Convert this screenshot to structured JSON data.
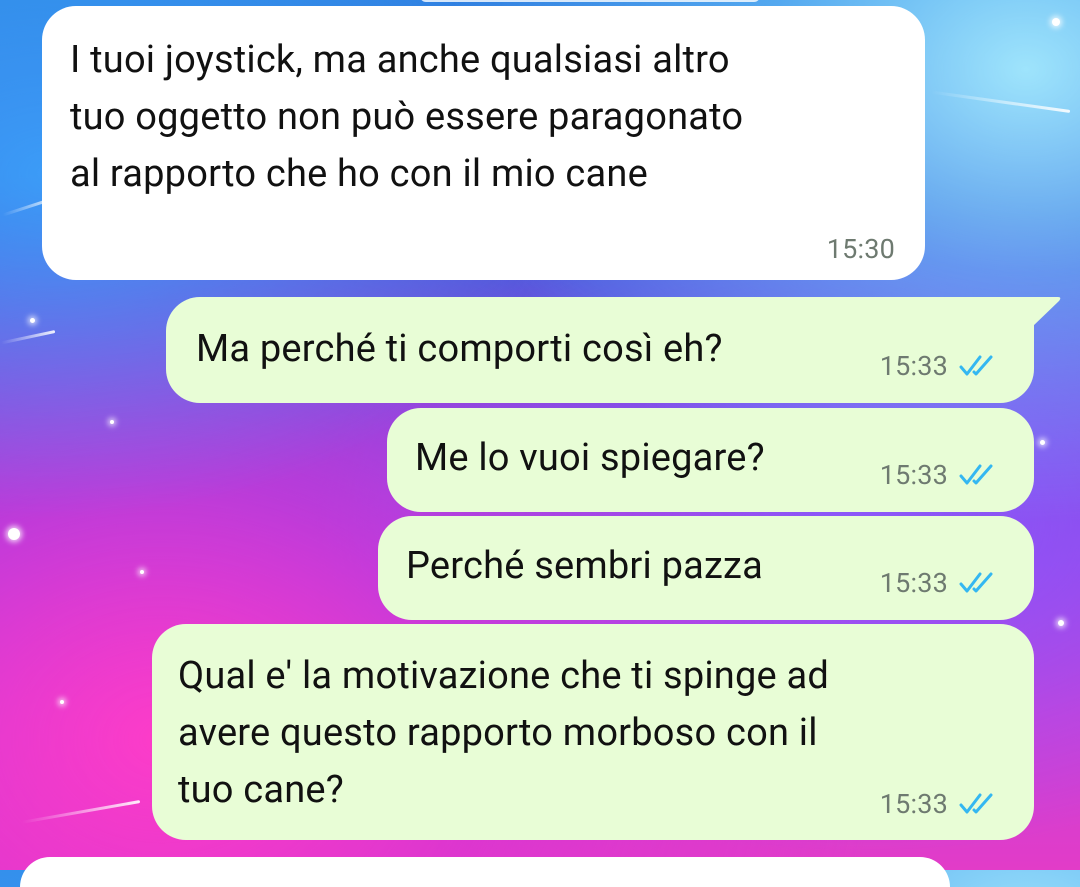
{
  "chat": {
    "messages": [
      {
        "direction": "incoming",
        "text": "I tuoi joystick, ma anche qualsiasi altro\ntuo oggetto non può essere paragonato\nal rapporto che ho con il mio cane",
        "time": "15:30"
      },
      {
        "direction": "outgoing",
        "text": "Ma perché ti comporti così eh?",
        "time": "15:33",
        "status_icon": "double-check-read-icon"
      },
      {
        "direction": "outgoing",
        "text": "Me lo vuoi spiegare?",
        "time": "15:33",
        "status_icon": "double-check-read-icon"
      },
      {
        "direction": "outgoing",
        "text": "Perché sembri pazza",
        "time": "15:33",
        "status_icon": "double-check-read-icon"
      },
      {
        "direction": "outgoing",
        "text": "Qual e' la motivazione che ti spinge ad\navere questo rapporto morboso con il\ntuo cane?",
        "time": "15:33",
        "status_icon": "double-check-read-icon"
      }
    ]
  },
  "colors": {
    "incoming_bubble": "#ffffff",
    "outgoing_bubble": "#e8fdd6",
    "read_ticks": "#34b7f1",
    "timestamp": "#6e7a70"
  }
}
